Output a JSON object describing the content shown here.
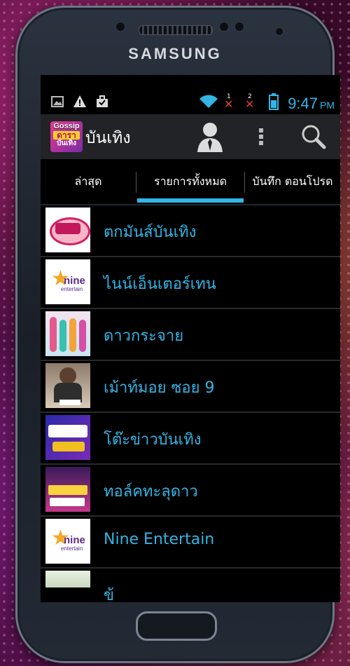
{
  "device": {
    "brand": "SAMSUNG"
  },
  "statusbar": {
    "time": "9:47",
    "ampm": "PM",
    "sim1": "1",
    "sim2": "2",
    "icons": [
      "image-icon",
      "warning-icon",
      "briefcase-icon",
      "wifi-icon",
      "signal-x-icon",
      "signal-x-icon",
      "battery-icon"
    ]
  },
  "actionbar": {
    "app_icon_lines": [
      "Gossip",
      "ดารา",
      "บันเทิง"
    ],
    "title": "บันเทิง",
    "buttons": [
      "person-icon",
      "overflow-menu-icon",
      "search-icon"
    ]
  },
  "tabs": [
    {
      "label": "ล่าสุด"
    },
    {
      "label": "รายการทั้งหมด",
      "selected": true
    },
    {
      "label": "บันทึก ตอนโปรด"
    }
  ],
  "list": [
    {
      "label": "ตกมันส์บันเทิง"
    },
    {
      "label": "ไนน์เอ็นเตอร์เทน"
    },
    {
      "label": "ดาวกระจาย"
    },
    {
      "label": "เม้าท์มอย ซอย 9"
    },
    {
      "label": "โต๊ะข่าวบันเทิง"
    },
    {
      "label": "ทอล์คทะลุดาว"
    },
    {
      "label": "Nine Entertain"
    },
    {
      "label": "ข้"
    }
  ],
  "colors": {
    "accent": "#33b5e5",
    "actionbar": "#222326",
    "background": "#000000"
  }
}
